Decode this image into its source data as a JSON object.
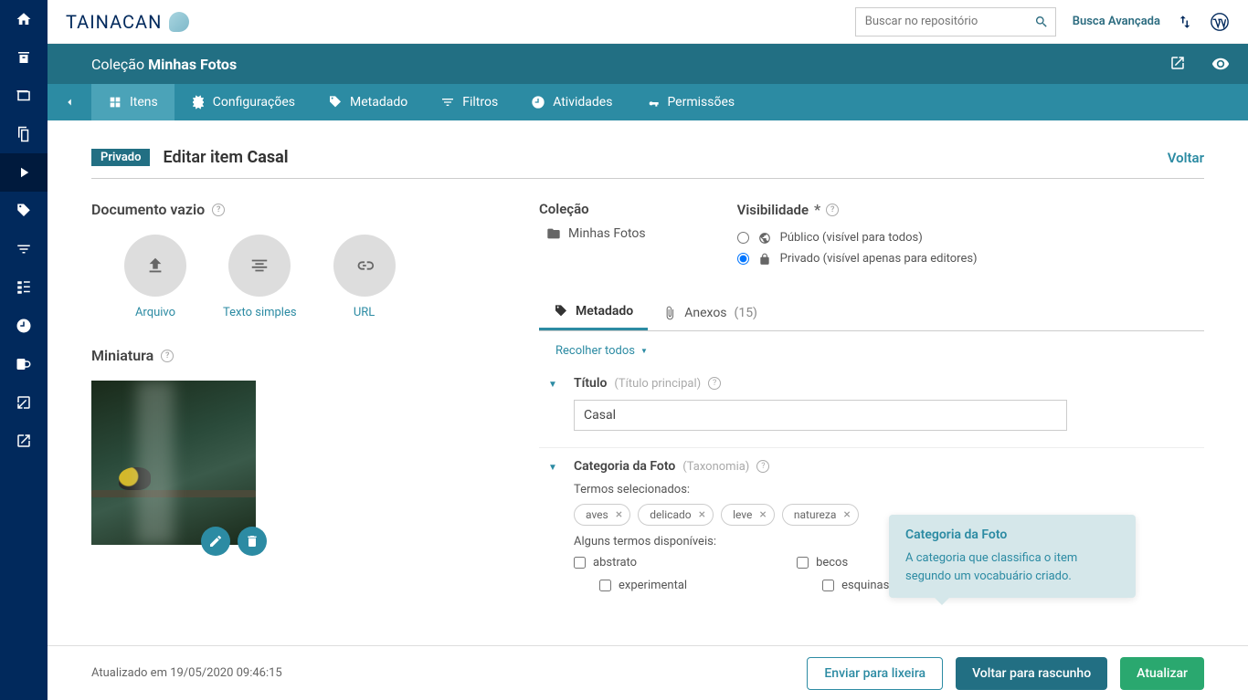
{
  "logo": "TAINACAN",
  "search": {
    "placeholder": "Buscar no repositório"
  },
  "advanced_search": "Busca Avançada",
  "collection_bar": {
    "label": "Coleção",
    "name": "Minhas Fotos"
  },
  "tabs": {
    "items": "Itens",
    "settings": "Configurações",
    "metadata": "Metadado",
    "filters": "Filtros",
    "activities": "Atividades",
    "permissions": "Permissões"
  },
  "page": {
    "private": "Privado",
    "title_prefix": "Editar item",
    "item_name": "Casal",
    "back": "Voltar"
  },
  "document": {
    "heading": "Documento vazio",
    "file": "Arquivo",
    "text": "Texto simples",
    "url": "URL"
  },
  "thumbnail": {
    "heading": "Miniatura"
  },
  "collection_info": {
    "label": "Coleção",
    "value": "Minhas Fotos"
  },
  "visibility": {
    "label": "Visibilidade",
    "public": "Público (visível para todos)",
    "private": "Privado (visível apenas para editores)"
  },
  "meta_tabs": {
    "metadata": "Metadado",
    "attachments": "Anexos",
    "attachments_count": "(15)"
  },
  "collapse_all": "Recolher todos",
  "fields": {
    "title": {
      "name": "Título",
      "type": "(Título principal)",
      "value": "Casal"
    },
    "category": {
      "name": "Categoria da Foto",
      "type": "(Taxonomia)",
      "selected_label": "Termos selecionados:",
      "available_label": "Alguns termos disponíveis:",
      "tags": [
        "aves",
        "delicado",
        "leve",
        "natureza"
      ],
      "terms": {
        "col1": [
          "abstrato",
          "experimental"
        ],
        "col2": [
          "becos",
          "esquinas"
        ]
      }
    }
  },
  "tooltip": {
    "title": "Categoria da Foto",
    "text": "A categoria que classifica o item segundo um vocabuário criado."
  },
  "footer": {
    "updated": "Atualizado em 19/05/2020 09:46:15",
    "trash": "Enviar para lixeira",
    "draft": "Voltar para rascunho",
    "update": "Atualizar"
  }
}
